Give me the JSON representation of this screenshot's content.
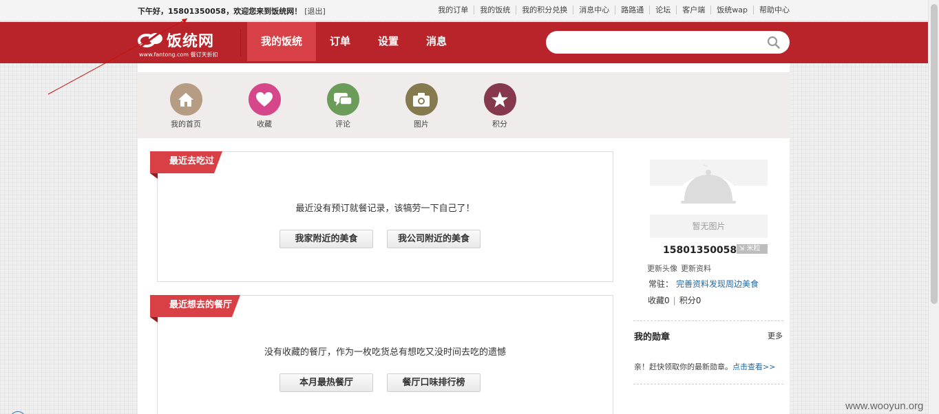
{
  "topbar": {
    "greeting": "下午好，15801350058，欢迎您来到饭统网！",
    "logout": "[退出]",
    "links": [
      "我的订单",
      "我的饭统",
      "我的积分兑换",
      "消息中心",
      "路路通",
      "论坛",
      "客户端",
      "饭统wap",
      "帮助中心"
    ]
  },
  "header": {
    "logo_text": "饭统网",
    "logo_url": "www.fantong.com 餐订天折扣",
    "nav": [
      "我的饭统",
      "订单",
      "设置",
      "消息"
    ],
    "active_nav": "我的饭统",
    "search_placeholder": ""
  },
  "iconbar": [
    {
      "label": "我的首页",
      "icon": "home-icon",
      "color": "#b79c84"
    },
    {
      "label": "收藏",
      "icon": "heart-icon",
      "color": "#d6468a"
    },
    {
      "label": "评论",
      "icon": "comment-icon",
      "color": "#6c9c59"
    },
    {
      "label": "图片",
      "icon": "camera-icon",
      "color": "#857a4e"
    },
    {
      "label": "积分",
      "icon": "star-icon",
      "color": "#86384d"
    }
  ],
  "panels": {
    "recent": {
      "title": "最近去吃过",
      "message": "最近没有预订就餐记录，该犒劳一下自己了！",
      "buttons": [
        "我家附近的美食",
        "我公司附近的美食"
      ]
    },
    "wish": {
      "title": "最近想去的餐厅",
      "message": "没有收藏的餐厅，作为一枚吃货总有想吃又没时间去吃的遗憾",
      "buttons": [
        "本月最热餐厅",
        "餐厅口味排行榜"
      ]
    }
  },
  "profile": {
    "no_image": "暂无图片",
    "username": "15801350058",
    "rice_badge": "米粒",
    "links": [
      "更新头像",
      "更新资料"
    ],
    "resident_label": "常驻：",
    "resident_link": "完善资料发现周边美食",
    "favorites": "收藏0",
    "points": "积分0",
    "badges_title": "我的勋章",
    "badges_more": "更多",
    "badges_text": "亲！赶快领取你的最新勋章。",
    "badges_link": "点击查看>>"
  },
  "watermark": "www.wooyun.org",
  "colors": {
    "header_red": "#b8242a",
    "nav_active": "#d84047",
    "ribbon": "#d94045",
    "link_blue": "#2468a4"
  }
}
